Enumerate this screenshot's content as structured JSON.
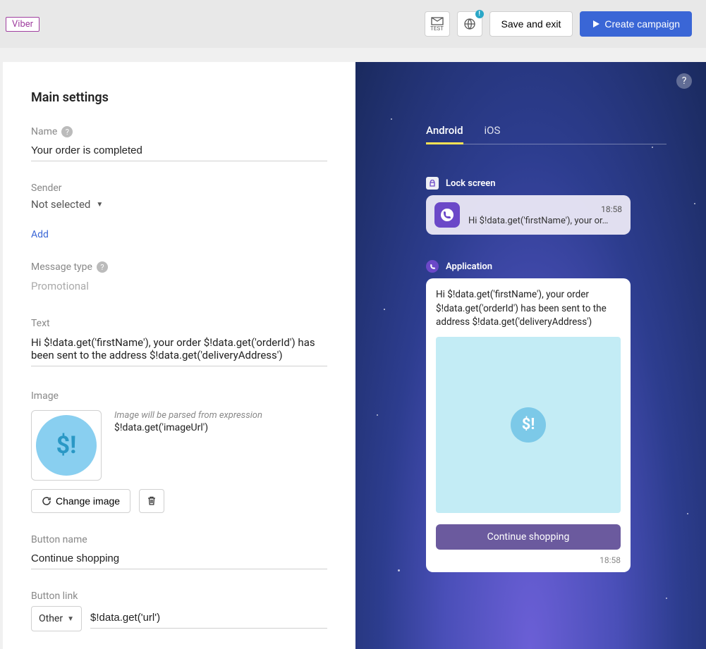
{
  "header": {
    "channel_tag": "Viber",
    "test_label": "TEST",
    "save_exit": "Save and exit",
    "create": "Create campaign"
  },
  "settings": {
    "title": "Main settings",
    "name_label": "Name",
    "name_value": "Your order is completed",
    "sender_label": "Sender",
    "sender_value": "Not selected",
    "add_link": "Add",
    "msgtype_label": "Message type",
    "msgtype_value": "Promotional",
    "text_label": "Text",
    "text_value": "Hi $!data.get('firstName'), your order $!data.get('orderId') has been sent to the address $!data.get('deliveryAddress')",
    "image_label": "Image",
    "image_note": "Image will be parsed from expression",
    "image_expr": "$!data.get('imageUrl')",
    "change_image": "Change image",
    "button_name_label": "Button name",
    "button_name_value": "Continue shopping",
    "button_link_label": "Button link",
    "link_type": "Other",
    "link_value": "$!data.get('url')"
  },
  "preview": {
    "tabs": {
      "android": "Android",
      "ios": "iOS"
    },
    "lock_label": "Lock screen",
    "app_label": "Application",
    "time": "18:58",
    "notif_text": "Hi $!data.get('firstName'), your or…",
    "msg_text": "Hi $!data.get('firstName'), your order $!data.get('orderId') has been sent to the address $!data.get('deliveryAddress')",
    "btn_text": "Continue shopping"
  }
}
